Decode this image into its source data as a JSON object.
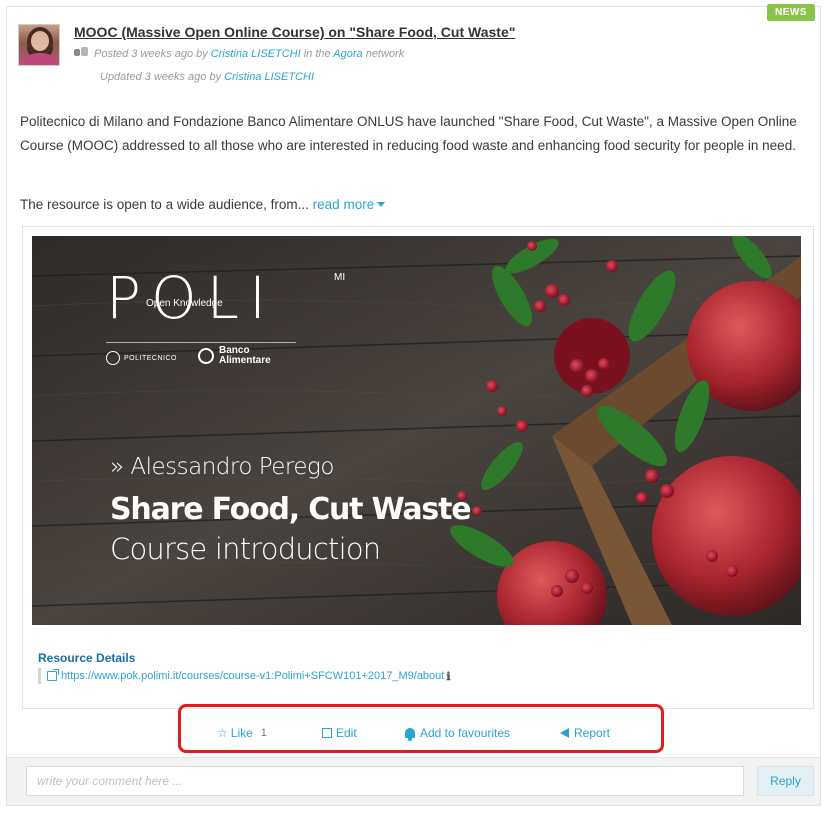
{
  "post": {
    "badge": "NEWS",
    "title": "MOOC (Massive Open Online Course) on \"Share Food, Cut Waste\"",
    "posted_prefix": "Posted 3 weeks ago by ",
    "posted_author": "Cristina LISETCHI",
    "posted_mid": " in the ",
    "posted_network": "Agora",
    "posted_suffix": " network",
    "updated_prefix": "Updated 3 weeks ago by ",
    "updated_author": "Cristina LISETCHI",
    "description": "Politecnico di Milano and Fondazione Banco Alimentare ONLUS have launched \"Share Food, Cut Waste\", a Massive Open Online Course (MOOC) addressed to all those who are interested in reducing food waste and enhancing food security for people in need.",
    "teaser": "The resource is open to a wide audience, from...",
    "read_more": "read more"
  },
  "banner": {
    "brand": "POLI",
    "brand_sup": "MI",
    "brand_sub": "Open Knowledge",
    "polimi_label": "POLITECNICO",
    "banco_line1": "Banco",
    "banco_line2": "Alimentare",
    "speaker": "» Alessandro Perego",
    "course_title": "Share Food, Cut Waste",
    "course_subtitle": "Course introduction"
  },
  "resource": {
    "details_title": "Resource Details",
    "link": "https://www.pok.polimi.it/courses/course-v1:Polimi+SFCW101+2017_M9/about"
  },
  "actions": {
    "like": "Like",
    "like_count": "1",
    "edit": "Edit",
    "favourites": "Add to favourites",
    "report": "Report"
  },
  "comment": {
    "placeholder": "write your comment here ...",
    "reply": "Reply"
  },
  "colors": {
    "link": "#2aa3d6",
    "badge": "#8bc34a",
    "highlight": "#e31b1b"
  }
}
